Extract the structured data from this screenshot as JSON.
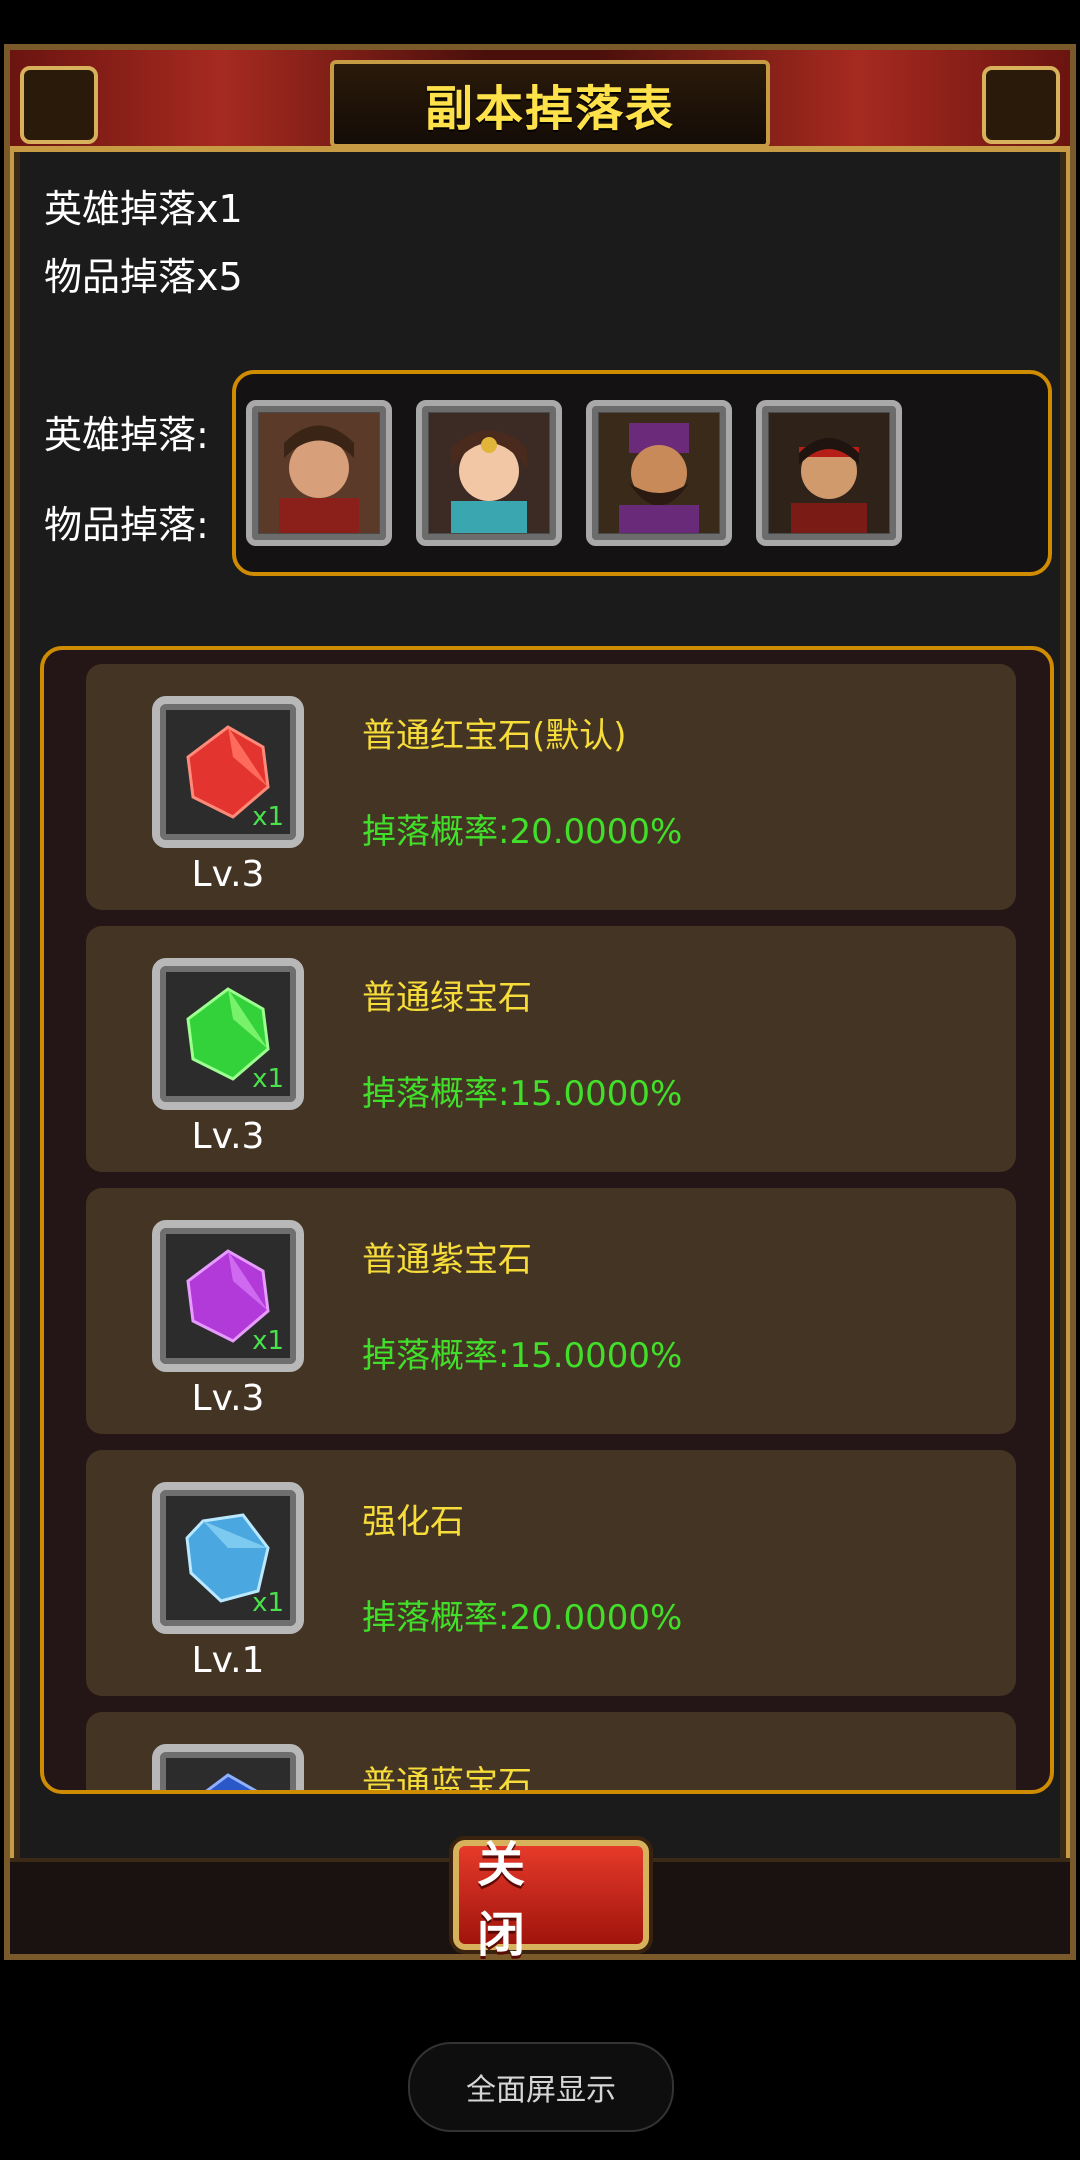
{
  "dialog": {
    "title": "副本掉落表",
    "hero_drop_count": "英雄掉落x1",
    "item_drop_count": "物品掉落x5",
    "hero_drop_label": "英雄掉落:",
    "item_drop_label": "物品掉落:",
    "close_label": "关 闭",
    "heroes": [
      {
        "name": "hero-1"
      },
      {
        "name": "hero-2"
      },
      {
        "name": "hero-3"
      },
      {
        "name": "hero-4"
      }
    ],
    "items": [
      {
        "name": "普通红宝石(默认)",
        "rate": "掉落概率:20.0000%",
        "level": "Lv.3",
        "qty": "x1",
        "color": "#e3342f"
      },
      {
        "name": "普通绿宝石",
        "rate": "掉落概率:15.0000%",
        "level": "Lv.3",
        "qty": "x1",
        "color": "#33d13a"
      },
      {
        "name": "普通紫宝石",
        "rate": "掉落概率:15.0000%",
        "level": "Lv.3",
        "qty": "x1",
        "color": "#b13ad8"
      },
      {
        "name": "强化石",
        "rate": "掉落概率:20.0000%",
        "level": "Lv.1",
        "qty": "x1",
        "color": "#4aa7e0"
      },
      {
        "name": "普通蓝宝石",
        "rate": "",
        "level": "",
        "qty": "",
        "color": "#2a58c8"
      }
    ]
  },
  "system": {
    "fullscreen_label": "全面屏显示"
  }
}
